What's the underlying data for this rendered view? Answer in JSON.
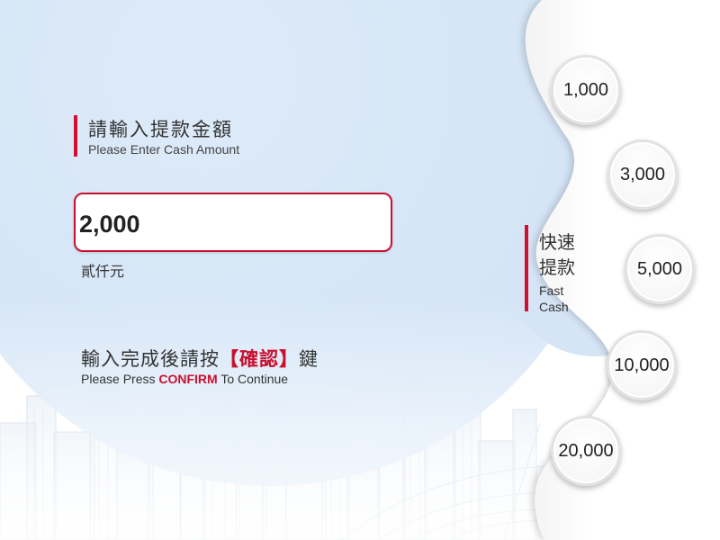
{
  "amount_section": {
    "title_zh": "請輸入提款金額",
    "title_en": "Please Enter Cash Amount",
    "input_value": "2,000",
    "amount_in_words": "貳仟元"
  },
  "confirm_hint": {
    "zh_before": "輸入完成後請按",
    "zh_key": "【確認】",
    "zh_after": "鍵",
    "en_before": "Please Press ",
    "en_key": "CONFIRM",
    "en_after": " To Continue"
  },
  "fast_cash": {
    "title_zh_line1": "快速",
    "title_zh_line2": "提款",
    "title_en_line1": "Fast",
    "title_en_line2": "Cash",
    "options": [
      "1,000",
      "3,000",
      "5,000",
      "10,000",
      "20,000"
    ]
  },
  "colors": {
    "accent_red": "#c8102e",
    "circle_blue": "#d3e4f6"
  }
}
